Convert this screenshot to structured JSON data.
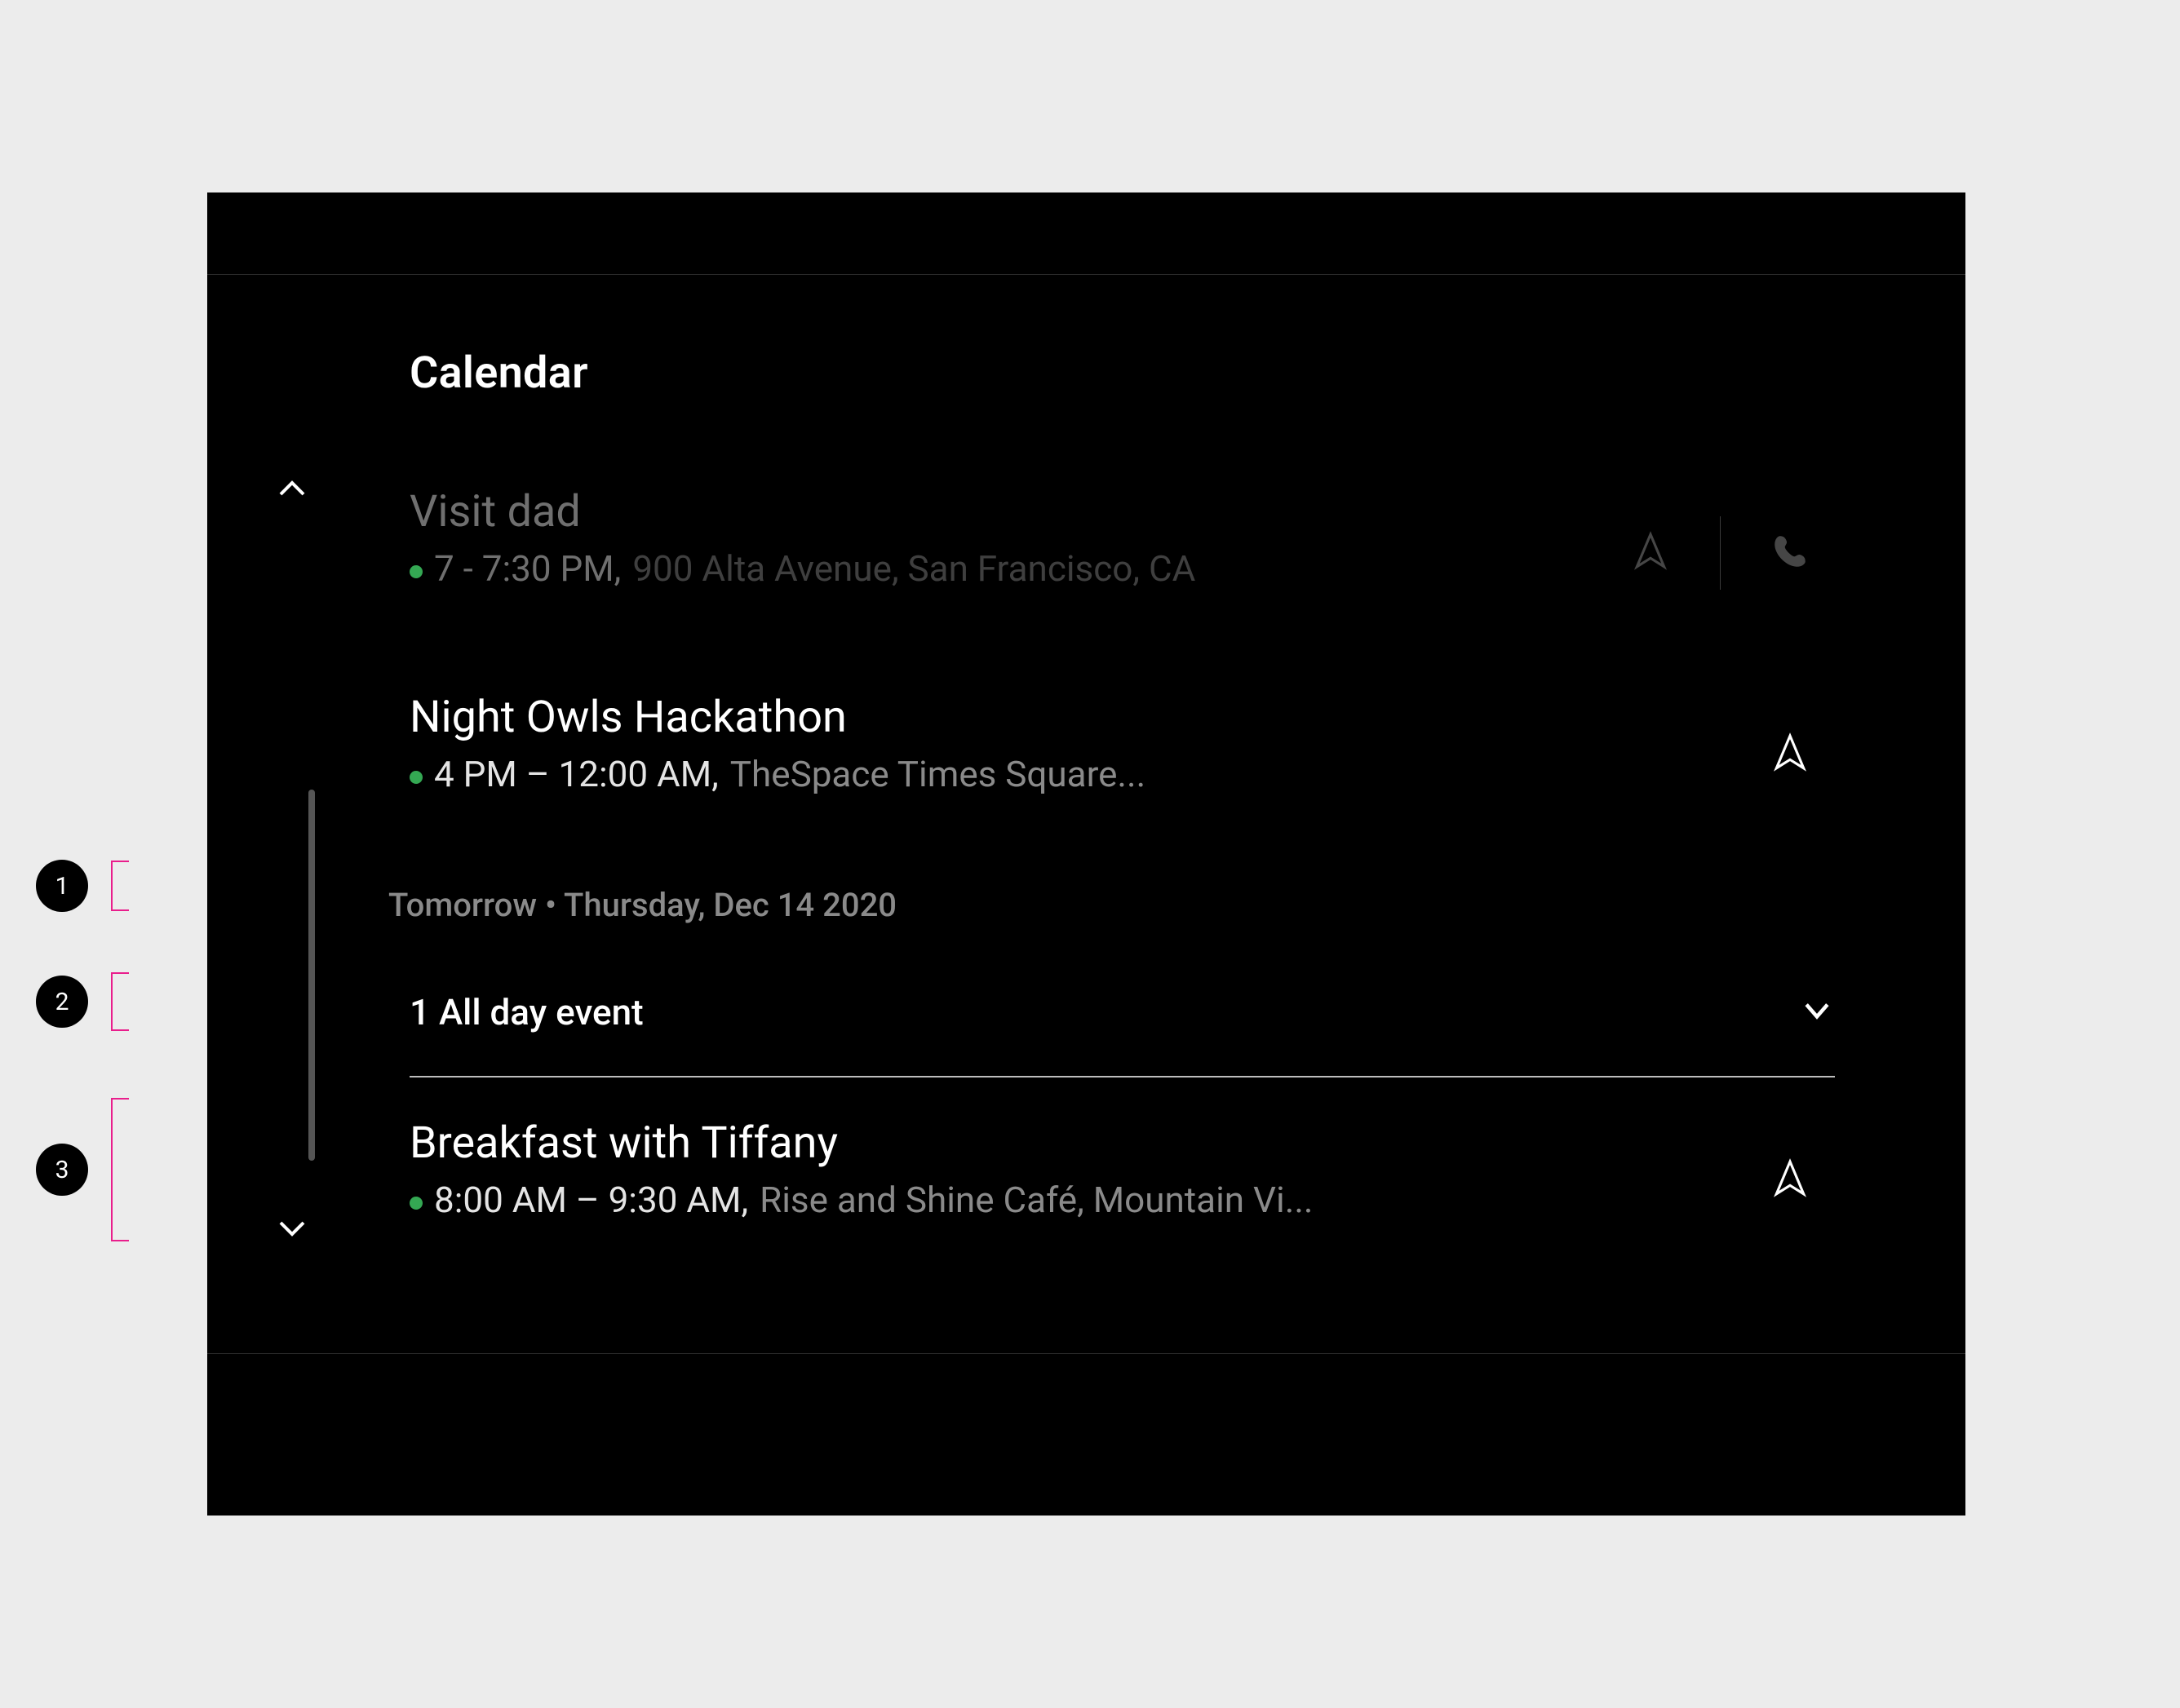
{
  "app": {
    "title": "Calendar"
  },
  "colors": {
    "accent_green": "#34a853",
    "annotation_pink": "#E91E8C"
  },
  "events": [
    {
      "title": "Visit dad",
      "time": "7 - 7:30 PM,",
      "location": "900 Alta Avenue, San Francisco, CA",
      "dot": true,
      "dimmed": true,
      "actions": {
        "navigate": true,
        "call": true
      }
    },
    {
      "title": "Night Owls Hackathon",
      "time": "4 PM – 12:00 AM,",
      "location": "TheSpace Times Square...",
      "dot": true,
      "dimmed": false,
      "actions": {
        "navigate": true,
        "call": false
      }
    },
    {
      "title": "Breakfast with Tiffany",
      "time": "8:00 AM – 9:30 AM,",
      "location": "Rise and Shine Café, Mountain Vi...",
      "dot": true,
      "dimmed": false,
      "actions": {
        "navigate": true,
        "call": false
      }
    }
  ],
  "section": {
    "label": "Tomorrow • Thursday, Dec 14 2020"
  },
  "allday": {
    "label": "1 All day event"
  },
  "annotations": [
    {
      "num": "1"
    },
    {
      "num": "2"
    },
    {
      "num": "3"
    }
  ]
}
